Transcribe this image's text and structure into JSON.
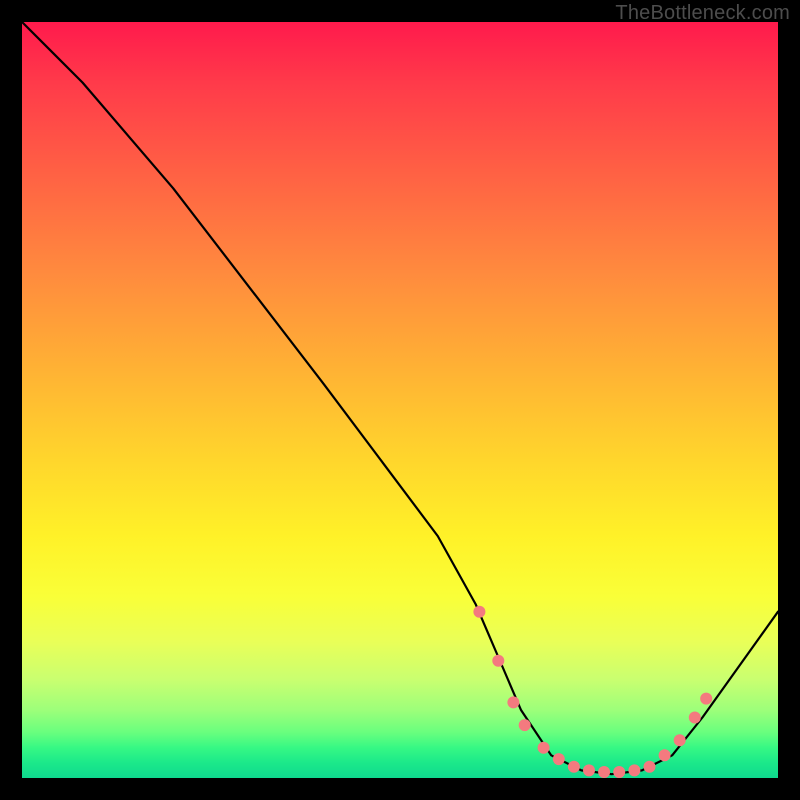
{
  "watermark": "TheBottleneck.com",
  "chart_data": {
    "type": "line",
    "title": "",
    "xlabel": "",
    "ylabel": "",
    "xlim": [
      0,
      100
    ],
    "ylim": [
      0,
      100
    ],
    "series": [
      {
        "name": "curve",
        "x": [
          0,
          4,
          8,
          20,
          40,
          55,
          60,
          63,
          66,
          70,
          74,
          78,
          82,
          86,
          90,
          100
        ],
        "y": [
          100,
          96,
          92,
          78,
          52,
          32,
          23,
          16,
          9,
          3,
          1,
          0.5,
          1,
          3,
          8,
          22
        ]
      }
    ],
    "markers": {
      "name": "dots",
      "color": "#f47a7f",
      "x": [
        60.5,
        63,
        65,
        66.5,
        69,
        71,
        73,
        75,
        77,
        79,
        81,
        83,
        85,
        87,
        89,
        90.5
      ],
      "y": [
        22,
        15.5,
        10,
        7,
        4,
        2.5,
        1.5,
        1,
        0.8,
        0.8,
        1,
        1.5,
        3,
        5,
        8,
        10.5
      ]
    },
    "background": {
      "gradient": "red-to-green-vertical"
    }
  }
}
